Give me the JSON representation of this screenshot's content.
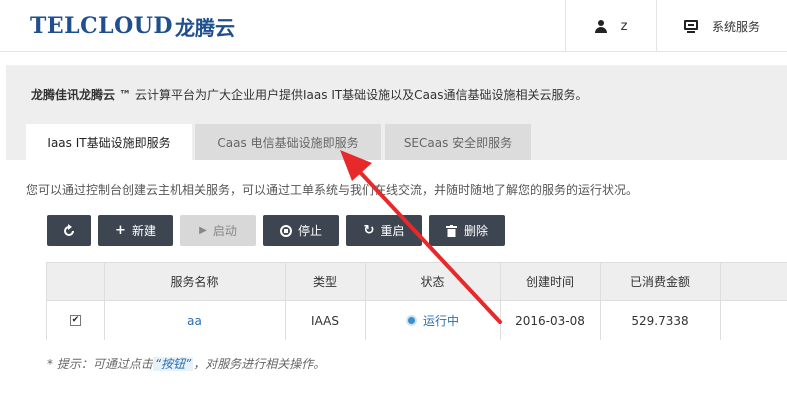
{
  "header": {
    "logo_en": "TELCLOUD",
    "logo_cn": "龙腾云",
    "user_name": "z",
    "services_label": "系统服务"
  },
  "intro": {
    "brand": "龙腾佳讯龙腾云 ™",
    "text": " 云计算平台为广大企业用户提供Iaas IT基础设施以及Caas通信基础设施相关云服务。"
  },
  "tabs": [
    {
      "label": "Iaas IT基础设施即服务",
      "active": true
    },
    {
      "label": "Caas 电信基础设施即服务",
      "active": false
    },
    {
      "label": "SECaas 安全即服务",
      "active": false
    }
  ],
  "description": "您可以通过控制台创建云主机相关服务，可以通过工单系统与我们在线交流，并随时随地了解您的服务的运行状况。",
  "toolbar": {
    "new_label": "新建",
    "start_label": "启动",
    "stop_label": "停止",
    "restart_label": "重启",
    "delete_label": "删除"
  },
  "table": {
    "headers": [
      "服务名称",
      "类型",
      "状态",
      "创建时间",
      "已消费金额"
    ],
    "rows": [
      {
        "checked": true,
        "name": "aa",
        "type": "IAAS",
        "status": "运行中",
        "created": "2016-03-08",
        "spent": "529.7338"
      }
    ]
  },
  "tip": {
    "prefix": "* 提示：可通过点击",
    "highlight": "“按钮”",
    "suffix": "，对服务进行相关操作。"
  },
  "colors": {
    "brand": "#1f4f8e",
    "button": "#3d4551",
    "annotation_arrow": "#e8292b",
    "link": "#2a6fb0"
  }
}
